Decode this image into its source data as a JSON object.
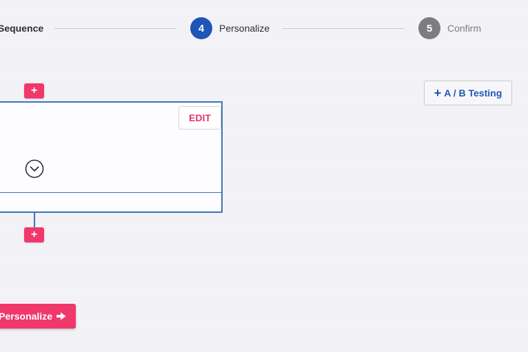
{
  "stepper": {
    "prev_step_label": "Sequence",
    "steps": [
      {
        "number": "4",
        "label": "Personalize",
        "state": "active"
      },
      {
        "number": "5",
        "label": "Confirm",
        "state": "inactive"
      }
    ]
  },
  "sequence": {
    "add_above_label": "+",
    "add_below_label": "+",
    "card": {
      "edit_label": "EDIT",
      "expand_icon": "chevron-down-circle-icon"
    }
  },
  "ab_testing": {
    "icon": "plus-icon",
    "plus_glyph": "+",
    "label": "A / B Testing"
  },
  "footer": {
    "next_label": "Personalize",
    "next_icon": "arrow-right-icon"
  },
  "colors": {
    "primary": "#1f55b8",
    "accent": "#f0386b",
    "inactive": "#7d7d80",
    "card_border": "#3b73b8"
  }
}
